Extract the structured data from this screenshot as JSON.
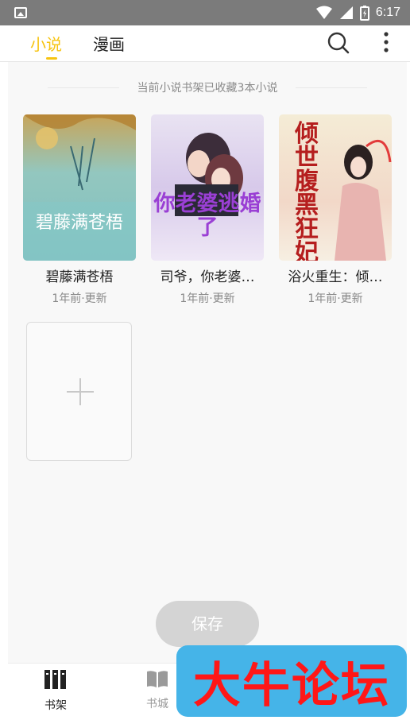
{
  "status_bar": {
    "time": "6:17"
  },
  "top_tabs": {
    "novel": "小说",
    "comic": "漫画"
  },
  "shelf": {
    "summary": "当前小说书架已收藏3本小说"
  },
  "books": [
    {
      "title": "碧藤满苍梧",
      "updated": "1年前·更新",
      "cover_text": "碧藤满苍梧"
    },
    {
      "title": "司爷，你老婆…",
      "updated": "1年前·更新",
      "cover_text": "你老婆逃婚了"
    },
    {
      "title": "浴火重生：倾…",
      "updated": "1年前·更新",
      "cover_text": "倾世腹黑狂妃"
    }
  ],
  "actions": {
    "save": "保存"
  },
  "bottom_nav": {
    "shelf": "书架",
    "store": "书城"
  },
  "watermark": "大牛论坛",
  "colors": {
    "accent": "#f7c412",
    "watermark_bg": "#45b4e8",
    "watermark_text": "#ff1717"
  }
}
